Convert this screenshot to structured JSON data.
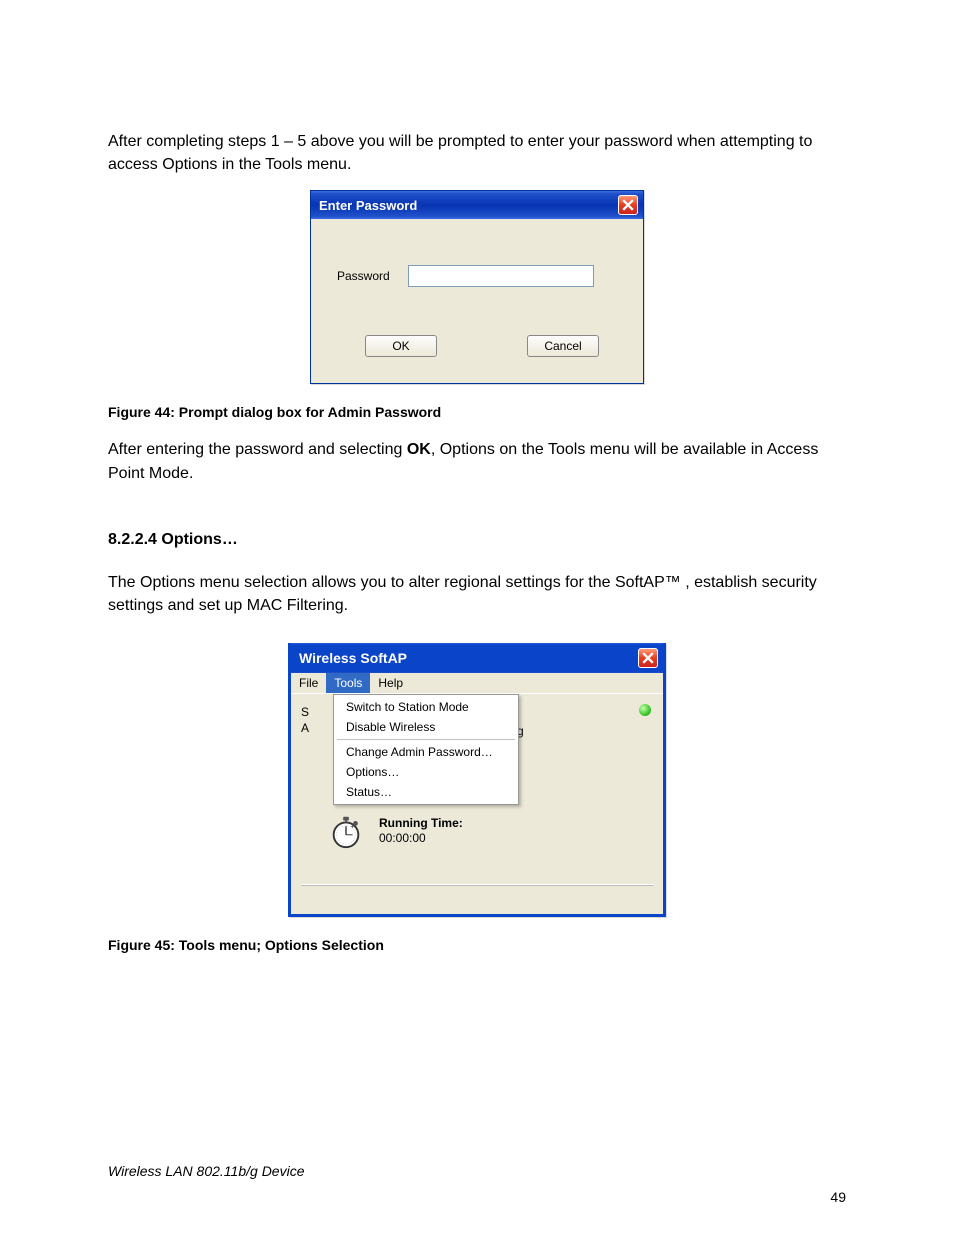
{
  "para1": "After completing steps 1 – 5 above you will be prompted to enter your password when attempting to access Options in the Tools menu.",
  "dialog1": {
    "title": "Enter Password",
    "password_label": "Password",
    "password_value": "",
    "ok": "OK",
    "cancel": "Cancel"
  },
  "fig44": "Figure 44: Prompt dialog box for Admin Password",
  "para2_a": "After entering the password and selecting ",
  "para2_b": "OK",
  "para2_c": ", Options on the Tools menu will be available in Access Point Mode.",
  "section_heading": "8.2.2.4  Options…",
  "para3": "The Options menu selection allows you to alter regional settings for the SoftAP™ , establish security settings and set up MAC Filtering.",
  "dialog2": {
    "title": "Wireless SoftAP",
    "menubar": {
      "file": "File",
      "tools": "Tools",
      "help": "Help"
    },
    "menu": {
      "switch": "Switch to Station Mode",
      "disable": "Disable Wireless",
      "change_pw": "Change Admin Password…",
      "options": "Options…",
      "status": "Status…"
    },
    "peek_right": "g",
    "running_label": "Running Time:",
    "running_time": "00:00:00"
  },
  "fig45": "Figure 45: Tools menu; Options Selection",
  "footer_left": "Wireless LAN 802.11b/g Device",
  "footer_right": "49"
}
